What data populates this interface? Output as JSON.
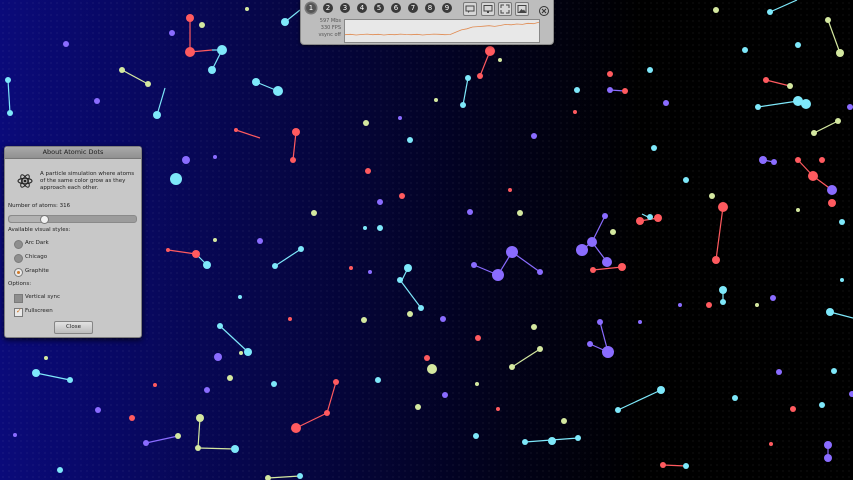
{
  "toolbar": {
    "style_buttons": [
      "1",
      "2",
      "3",
      "4",
      "5",
      "6",
      "7",
      "8",
      "9"
    ],
    "active_style": 0,
    "stats": {
      "memory": "597 Mbs",
      "fps": "330 FPS",
      "vsync": "vsync off"
    },
    "icons": [
      "chat-icon",
      "monitor-icon",
      "fullscreen-icon",
      "screenshot-icon",
      "close-icon"
    ],
    "fps_history": [
      0.33,
      0.35,
      0.32,
      0.34,
      0.36,
      0.33,
      0.35,
      0.32,
      0.34,
      0.33,
      0.36,
      0.34,
      0.33,
      0.35,
      0.32,
      0.34,
      0.36,
      0.35,
      0.33,
      0.34,
      0.45,
      0.55,
      0.6,
      0.68,
      0.7,
      0.72,
      0.74,
      0.71,
      0.75,
      0.8,
      0.78,
      0.82,
      0.8,
      0.85,
      0.83,
      0.9
    ]
  },
  "dialog": {
    "title": "About Atomic Dots",
    "description": "A particle simulation where atoms of the same color grow as they approach each other.",
    "atoms_label": "Number of atoms: 316",
    "atoms_fraction": 0.27,
    "styles_label": "Available visual styles:",
    "styles": [
      {
        "label": "Arc Dark",
        "checked": false
      },
      {
        "label": "Chicago",
        "checked": false
      },
      {
        "label": "Graphite",
        "checked": true
      }
    ],
    "options_label": "Options:",
    "options": [
      {
        "label": "Vertical sync",
        "checked": false
      },
      {
        "label": "Fullscreen",
        "checked": true
      }
    ],
    "close_label": "Close"
  },
  "colors": {
    "red": "#ff5a5f",
    "cyan": "#7ee8fa",
    "violet": "#8a6cff",
    "yellow": "#d4e8a0",
    "lavender": "#9c88ff"
  }
}
